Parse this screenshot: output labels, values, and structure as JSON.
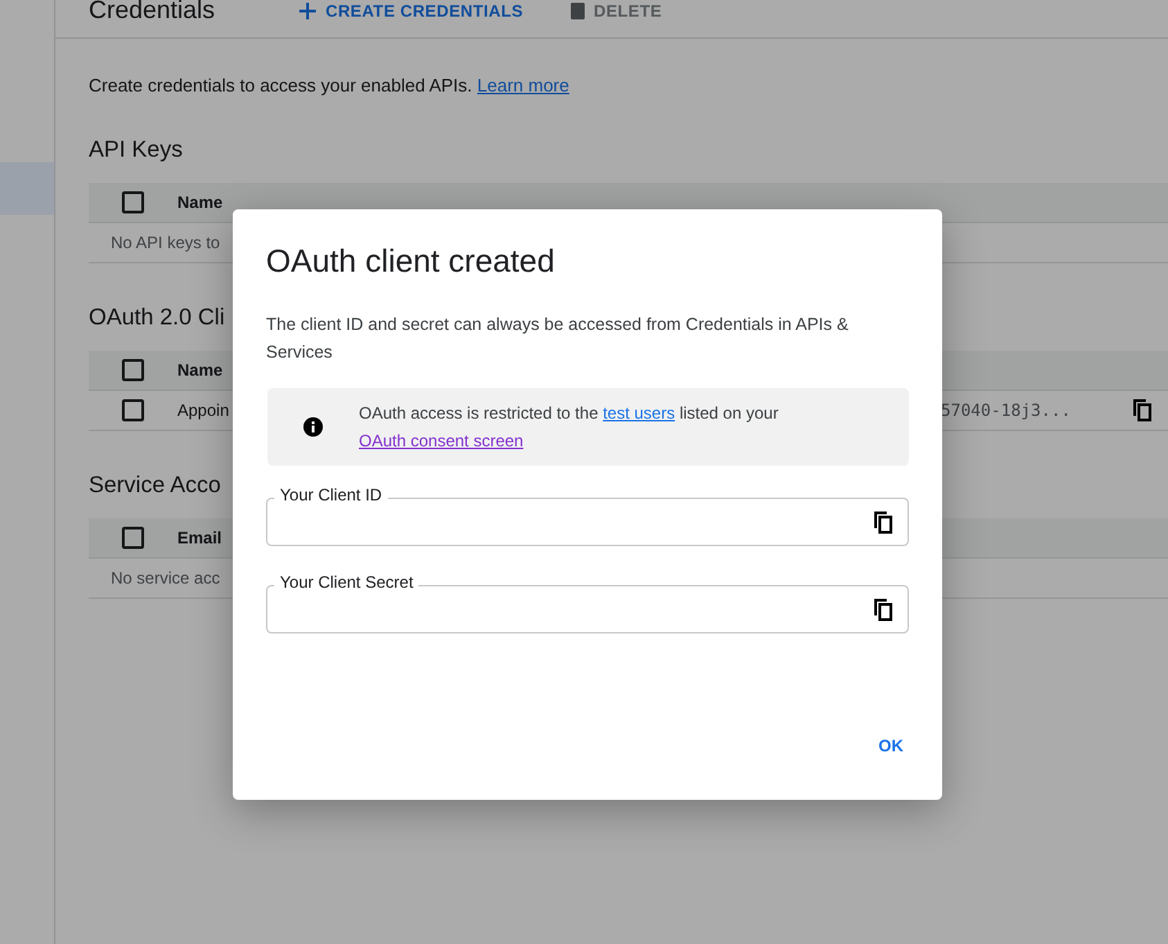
{
  "header": {
    "title": "Credentials",
    "actions": [
      {
        "label": "CREATE CREDENTIALS",
        "kind": "create",
        "disabled": false
      },
      {
        "label": "DELETE",
        "kind": "delete",
        "disabled": true
      }
    ]
  },
  "sidebar": {
    "items": [
      {
        "selected": true
      }
    ]
  },
  "intro": {
    "text": "Create credentials to access your enabled APIs.",
    "link": "Learn more"
  },
  "sections": [
    {
      "title": "API Keys",
      "columns": [
        {
          "label": "Name"
        }
      ],
      "header_checked": false,
      "empty": "No API keys to"
    },
    {
      "title": "OAuth 2.0 Cli",
      "columns": [
        {
          "label": "Name"
        }
      ],
      "header_checked": false,
      "rows": [
        {
          "name": "Appoin",
          "client_id": "57040-18j3...",
          "checked": false
        }
      ]
    },
    {
      "title": "Service Acco",
      "columns": [
        {
          "label": "Email"
        }
      ],
      "header_checked": false,
      "empty": "No service acc"
    }
  ],
  "dialog": {
    "title": "OAuth client created",
    "text": "The client ID and secret can always be accessed from Credentials in APIs & Services",
    "notice": [
      {
        "text": "OAuth access is restricted to the ",
        "kind": "plain"
      },
      {
        "text": "test users",
        "kind": "link"
      },
      {
        "text": " listed on your ",
        "kind": "plain"
      },
      {
        "text": "OAuth consent screen",
        "kind": "visited_link"
      }
    ],
    "fields": [
      {
        "label": "Your Client ID"
      },
      {
        "label": "Your Client Secret"
      }
    ],
    "button": "OK"
  }
}
